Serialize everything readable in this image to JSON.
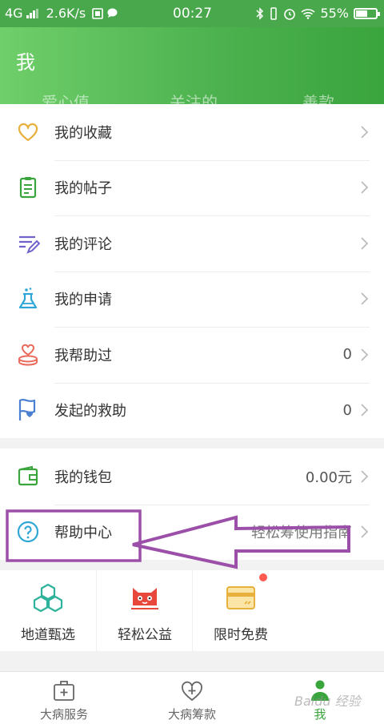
{
  "status_bar": {
    "network": "4G",
    "speed": "2.6K/s",
    "time": "00:27",
    "battery": "55%"
  },
  "header": {
    "title": "我",
    "stats": [
      "爱心值",
      "关注的",
      "善款"
    ]
  },
  "menu_group_1": [
    {
      "label": "我的收藏",
      "icon": "heart-icon",
      "value": ""
    },
    {
      "label": "我的帖子",
      "icon": "clipboard-icon",
      "value": ""
    },
    {
      "label": "我的评论",
      "icon": "edit-lines-icon",
      "value": ""
    },
    {
      "label": "我的申请",
      "icon": "flask-icon",
      "value": ""
    },
    {
      "label": "我帮助过",
      "icon": "helping-hand-icon",
      "value": "0"
    },
    {
      "label": "发起的救助",
      "icon": "flag-heart-icon",
      "value": "0"
    }
  ],
  "menu_group_2": [
    {
      "label": "我的钱包",
      "icon": "wallet-icon",
      "value": "0.00元"
    },
    {
      "label": "帮助中心",
      "icon": "question-circle-icon",
      "value": "轻松筹使用指南"
    }
  ],
  "shortcuts": [
    {
      "label": "地道甄选",
      "icon": "cubes-icon",
      "badge": false
    },
    {
      "label": "轻松公益",
      "icon": "cat-icon",
      "badge": false
    },
    {
      "label": "限时免费",
      "icon": "card-icon",
      "badge": true
    }
  ],
  "tabbar": [
    {
      "label": "大病服务",
      "icon": "medical-kit-icon",
      "active": false
    },
    {
      "label": "大病筹款",
      "icon": "heart-plus-icon",
      "active": false
    },
    {
      "label": "我",
      "icon": "person-icon",
      "active": true
    }
  ],
  "colors": {
    "brand_green": "#4aa84c",
    "annotation_purple": "#9b4fa8",
    "badge_red": "#ff5a4f"
  },
  "watermark": "Baidu 经验"
}
